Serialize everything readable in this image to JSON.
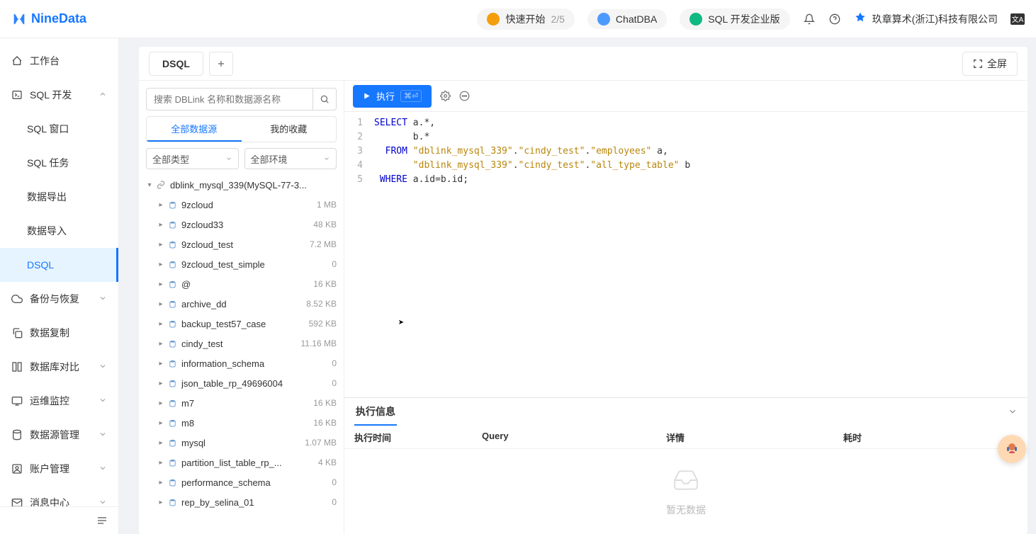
{
  "header": {
    "logo": "NineData",
    "quickstart": {
      "label": "快速开始",
      "progress": "2/5"
    },
    "chatdba": "ChatDBA",
    "edition": "SQL 开发企业版",
    "org": "玖章算术(浙江)科技有限公司",
    "lang": "文A"
  },
  "sidebar": {
    "items": [
      {
        "id": "workbench",
        "label": "工作台",
        "icon": "home",
        "expandable": false
      },
      {
        "id": "sqldev",
        "label": "SQL 开发",
        "icon": "terminal",
        "expandable": true,
        "expanded": true,
        "children": [
          {
            "id": "sqlwin",
            "label": "SQL 窗口"
          },
          {
            "id": "sqltask",
            "label": "SQL 任务"
          },
          {
            "id": "export",
            "label": "数据导出"
          },
          {
            "id": "import",
            "label": "数据导入"
          },
          {
            "id": "dsql",
            "label": "DSQL",
            "active": true
          }
        ]
      },
      {
        "id": "backup",
        "label": "备份与恢复",
        "icon": "cloud",
        "expandable": true
      },
      {
        "id": "replicate",
        "label": "数据复制",
        "icon": "copy",
        "expandable": false
      },
      {
        "id": "compare",
        "label": "数据库对比",
        "icon": "diff",
        "expandable": true
      },
      {
        "id": "monitor",
        "label": "运维监控",
        "icon": "monitor",
        "expandable": true
      },
      {
        "id": "datasource",
        "label": "数据源管理",
        "icon": "db",
        "expandable": true
      },
      {
        "id": "account",
        "label": "账户管理",
        "icon": "user",
        "expandable": true
      },
      {
        "id": "message",
        "label": "消息中心",
        "icon": "mail",
        "expandable": true
      }
    ]
  },
  "tabs": {
    "active": "DSQL",
    "fullscreen": "全屏"
  },
  "explorer": {
    "search_placeholder": "搜索 DBLink 名称和数据源名称",
    "seg_all": "全部数据源",
    "seg_fav": "我的收藏",
    "filter_type": "全部类型",
    "filter_env": "全部环境",
    "root": "dblink_mysql_339(MySQL-77-3...",
    "dbs": [
      {
        "name": "9zcloud",
        "size": "1 MB"
      },
      {
        "name": "9zcloud33",
        "size": "48 KB"
      },
      {
        "name": "9zcloud_test",
        "size": "7.2 MB"
      },
      {
        "name": "9zcloud_test_simple",
        "size": "0"
      },
      {
        "name": "@",
        "size": "16 KB"
      },
      {
        "name": "archive_dd",
        "size": "8.52 KB"
      },
      {
        "name": "backup_test57_case",
        "size": "592 KB"
      },
      {
        "name": "cindy_test",
        "size": "11.16 MB"
      },
      {
        "name": "information_schema",
        "size": "0"
      },
      {
        "name": "json_table_rp_49696004",
        "size": "0"
      },
      {
        "name": "m7",
        "size": "16 KB"
      },
      {
        "name": "m8",
        "size": "16 KB"
      },
      {
        "name": "mysql",
        "size": "1.07 MB"
      },
      {
        "name": "partition_list_table_rp_...",
        "size": "4 KB"
      },
      {
        "name": "performance_schema",
        "size": "0"
      },
      {
        "name": "rep_by_selina_01",
        "size": "0"
      }
    ]
  },
  "editor": {
    "run": "执行",
    "shortcut": "⌘⏎",
    "lines": [
      [
        {
          "t": "kw",
          "v": "SELECT"
        },
        {
          "t": "",
          "v": " a.*,"
        }
      ],
      [
        {
          "t": "",
          "v": "       b.*"
        }
      ],
      [
        {
          "t": "",
          "v": "  "
        },
        {
          "t": "kw",
          "v": "FROM"
        },
        {
          "t": "",
          "v": " "
        },
        {
          "t": "str",
          "v": "\"dblink_mysql_339\""
        },
        {
          "t": "",
          "v": "."
        },
        {
          "t": "str",
          "v": "\"cindy_test\""
        },
        {
          "t": "",
          "v": "."
        },
        {
          "t": "str",
          "v": "\"employees\""
        },
        {
          "t": "",
          "v": " a,"
        }
      ],
      [
        {
          "t": "",
          "v": "       "
        },
        {
          "t": "str",
          "v": "\"dblink_mysql_339\""
        },
        {
          "t": "",
          "v": "."
        },
        {
          "t": "str",
          "v": "\"cindy_test\""
        },
        {
          "t": "",
          "v": "."
        },
        {
          "t": "str",
          "v": "\"all_type_table\""
        },
        {
          "t": "",
          "v": " b"
        }
      ],
      [
        {
          "t": "",
          "v": " "
        },
        {
          "t": "kw",
          "v": "WHERE"
        },
        {
          "t": "",
          "v": " a.id=b.id;"
        }
      ]
    ]
  },
  "exec": {
    "tab": "执行信息",
    "col_time": "执行时间",
    "col_query": "Query",
    "col_detail": "详情",
    "col_cost": "耗时",
    "empty": "暂无数据"
  }
}
